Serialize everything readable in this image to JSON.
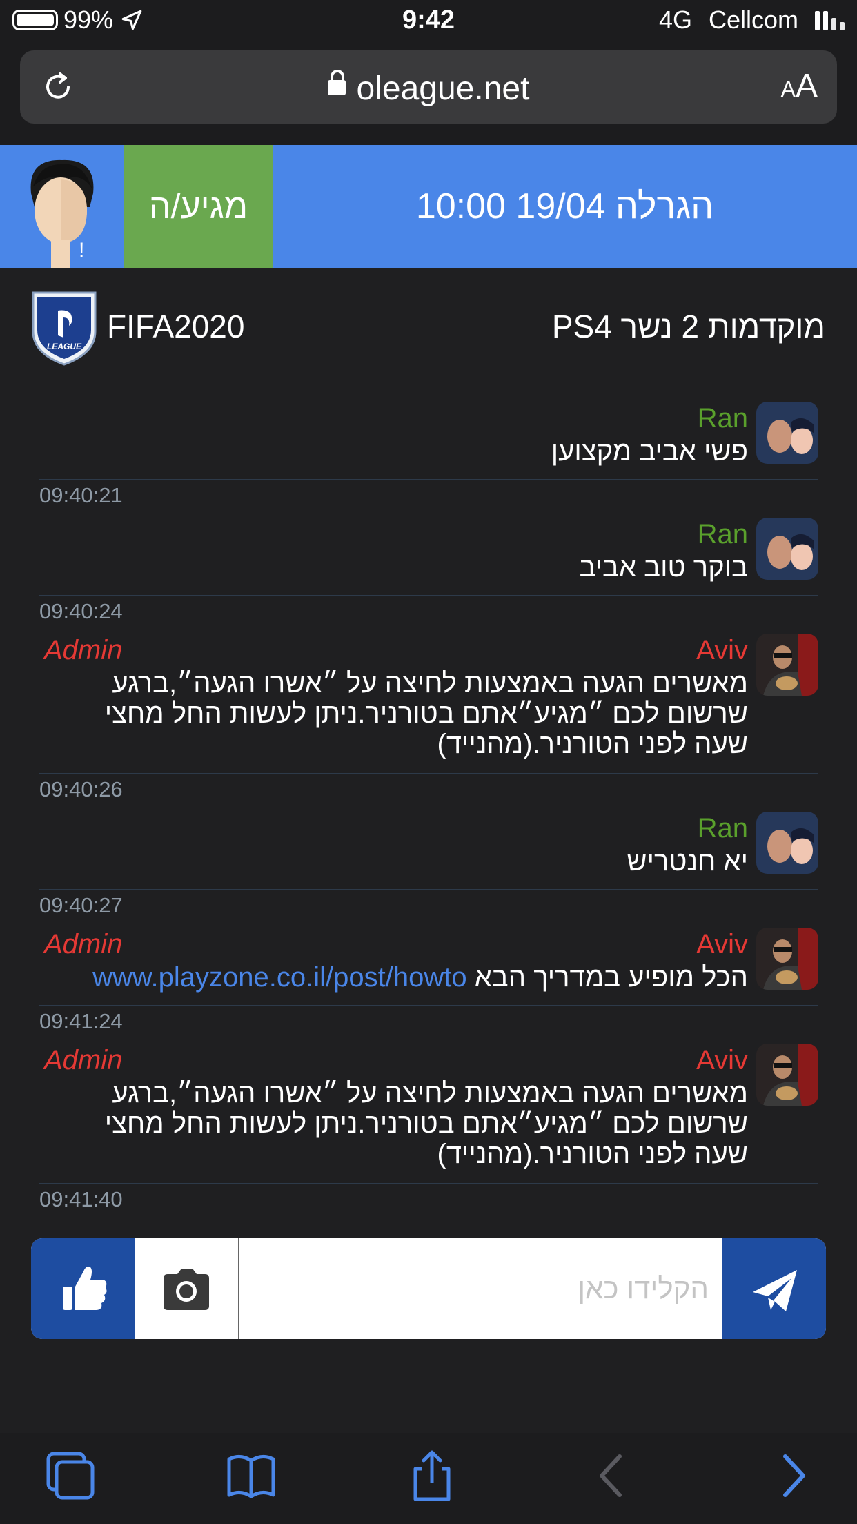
{
  "status_bar": {
    "battery": "99%",
    "time": "9:42",
    "network": "4G",
    "carrier": "Cellcom"
  },
  "browser": {
    "url": "oleague.net",
    "text_size_label": "AA"
  },
  "banner": {
    "arrive_label": "מגיע/ה",
    "draw_label": "הגרלה 19/04 10:00",
    "alert_mark": "!"
  },
  "tournament": {
    "game": "FIFA2020",
    "name": "מוקדמות 2 נשר PS4",
    "logo_text": "LEAGUE"
  },
  "messages": [
    {
      "sender": "Ran",
      "admin": "",
      "text": "פשי אביב מקצוען",
      "time": "09:40:21"
    },
    {
      "sender": "Ran",
      "admin": "",
      "text": "בוקר טוב אביב",
      "time": "09:40:24"
    },
    {
      "sender": "Aviv",
      "admin": "Admin",
      "text": "מאשרים הגעה באמצעות לחיצה על ״אשרו הגעה״,ברגע שרשום לכם ״מגיע״אתם בטורניר.ניתן לעשות החל מחצי שעה לפני הטורניר.(מהנייד)",
      "time": "09:40:26"
    },
    {
      "sender": "Ran",
      "admin": "",
      "text": "יא חנטריש",
      "time": "09:40:27"
    },
    {
      "sender": "Aviv",
      "admin": "Admin",
      "text": "הכל מופיע במדריך הבא",
      "link": "www.playzone.co.il/post/howto",
      "time": "09:41:24"
    },
    {
      "sender": "Aviv",
      "admin": "Admin",
      "text": "מאשרים הגעה באמצעות לחיצה על ״אשרו הגעה״,ברגע שרשום לכם ״מגיע״אתם בטורניר.ניתן לעשות החל מחצי שעה לפני הטורניר.(מהנייד)",
      "time": "09:41:40"
    }
  ],
  "composer": {
    "placeholder": "הקלידו כאן"
  },
  "colors": {
    "banner_blue": "#4a86e8",
    "arrive_green": "#6aa84f",
    "button_blue": "#1e4da1",
    "ran_green": "#5aa02c",
    "admin_red": "#e53935"
  },
  "toolbar_icons": [
    "tabs-icon",
    "bookmarks-icon",
    "share-icon",
    "back-icon",
    "forward-icon"
  ]
}
